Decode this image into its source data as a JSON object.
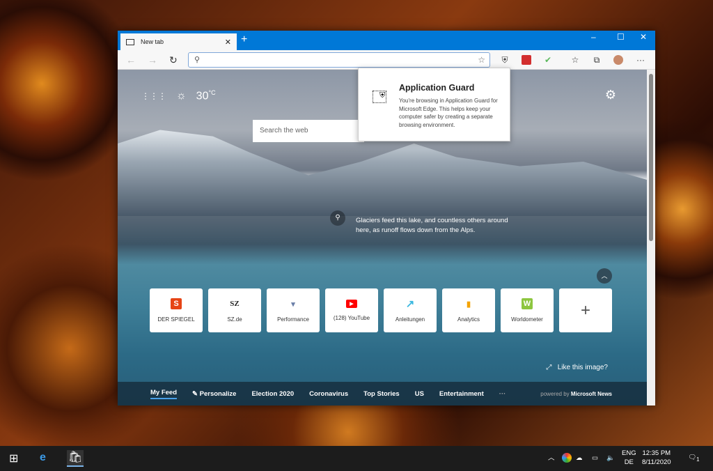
{
  "browser": {
    "tab_title": "New tab",
    "new_tab": "+",
    "minimize": "‒",
    "maximize": "☐",
    "close": "✕",
    "tab_close": "✕"
  },
  "toolbar": {
    "back": "←",
    "forward": "→",
    "refresh": "↻",
    "address_value": "",
    "favorite": "☆",
    "more": "···"
  },
  "popup": {
    "title": "Application Guard",
    "body": "You're browsing in Application Guard for Microsoft Edge. This helps keep your computer safer by creating a separate browsing environment."
  },
  "newtab": {
    "weather_temp": "30",
    "weather_unit": "°C",
    "search_placeholder": "Search the web",
    "caption": "Glaciers feed this lake, and countless others around here, as runoff flows down from the Alps.",
    "like_image": "Like this image?",
    "tiles": [
      {
        "label": "DER SPIEGEL",
        "logo": "S",
        "color": "#e64415"
      },
      {
        "label": "SZ.de",
        "logo": "SZ",
        "color": "#ffffff"
      },
      {
        "label": "Performance",
        "logo": "▾",
        "color": "#6b7fa8"
      },
      {
        "label": "(128) YouTube",
        "logo": "▶",
        "color": "#ff0000"
      },
      {
        "label": "Anleitungen",
        "logo": "↗",
        "color": "#3bb8e0"
      },
      {
        "label": "Analytics",
        "logo": "▮",
        "color": "#f4a300"
      },
      {
        "label": "Worldometer",
        "logo": "W",
        "color": "#8dc63f"
      },
      {
        "label": "",
        "logo": "+",
        "color": "#ffffff"
      }
    ],
    "feed": [
      "My Feed",
      "Personalize",
      "Election 2020",
      "Coronavirus",
      "Top Stories",
      "US",
      "Entertainment",
      "···"
    ],
    "powered_by": "powered by",
    "news_brand": "Microsoft News"
  },
  "taskbar": {
    "lang1": "ENG",
    "lang2": "DE",
    "time": "12:35 PM",
    "date": "8/11/2020",
    "notifications": "1"
  }
}
